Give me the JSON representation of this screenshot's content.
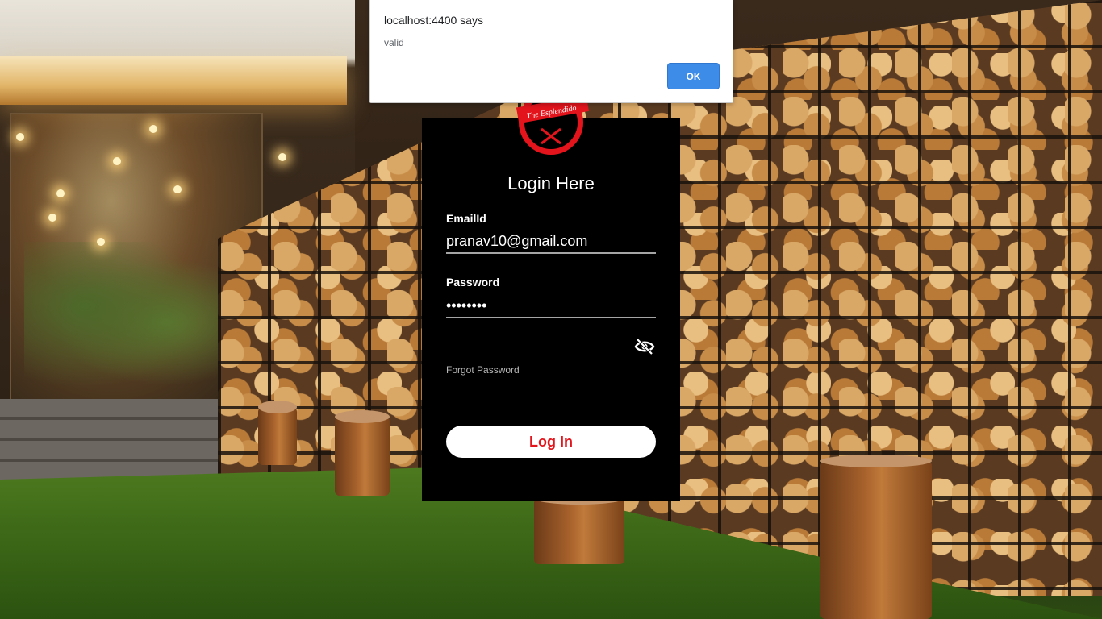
{
  "alert": {
    "title": "localhost:4400 says",
    "message": "valid",
    "ok_label": "OK"
  },
  "login": {
    "logo_text": "The Esplendido",
    "title": "Login Here",
    "email_label": "EmailId",
    "email_value": "pranav10@gmail.com",
    "password_label": "Password",
    "password_value": "••••••••",
    "forgot_label": "Forgot Password",
    "login_button": "Log In"
  },
  "colors": {
    "card_bg": "#000000",
    "button_text": "#e3141c",
    "alert_button": "#3c8ce8",
    "logo_red": "#e3141c"
  },
  "icons": {
    "password_toggle": "eye-slash-icon"
  }
}
